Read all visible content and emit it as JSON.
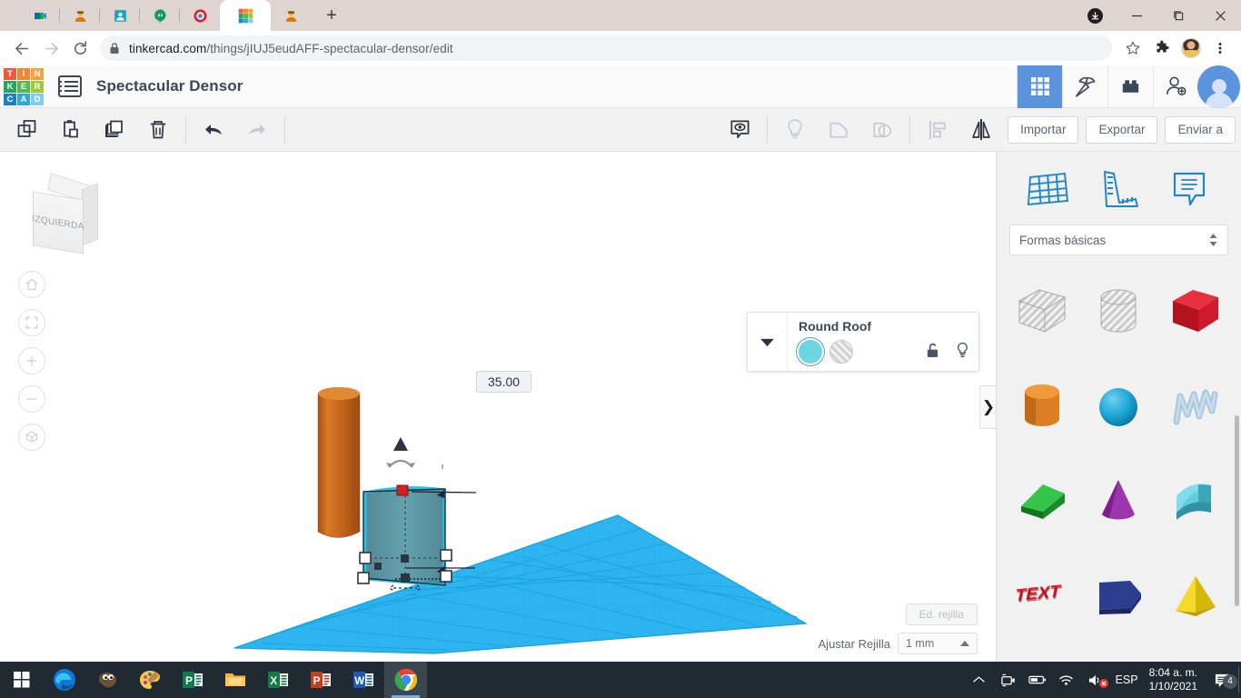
{
  "browser": {
    "tabs": [
      {
        "name": "google-meet-tab",
        "icon": "meet-icon",
        "active": false
      },
      {
        "name": "classroom-tab",
        "icon": "classroom-icon",
        "active": false
      },
      {
        "name": "contacts-tab",
        "icon": "contacts-icon",
        "active": false
      },
      {
        "name": "hangouts-tab",
        "icon": "hangouts-icon",
        "active": false
      },
      {
        "name": "screencast-tab",
        "icon": "screencast-icon",
        "active": false
      },
      {
        "name": "tinkercad-tab",
        "icon": "tinkercad-icon",
        "active": true
      },
      {
        "name": "classroom-tab-2",
        "icon": "classroom-icon",
        "active": false
      }
    ],
    "new_tab_label": "+",
    "url_bold": "tinkercad.com",
    "url_rest": "/things/jIUJ5eudAFF-spectacular-densor/edit",
    "lock_icon": "lock-icon",
    "back_icon": "back-arrow-icon",
    "forward_icon": "forward-arrow-icon",
    "reload_icon": "reload-icon",
    "star_icon": "bookmark-star-icon",
    "extensions_icon": "puzzle-extension-icon",
    "profile_icon": "profile-avatar",
    "menu_icon": "three-dot-menu-icon",
    "download_icon": "download-icon",
    "minimize_icon": "minimize-icon",
    "maximize_icon": "maximize-icon",
    "close_icon": "close-icon"
  },
  "tinkercad": {
    "logo_letters": [
      "T",
      "I",
      "N",
      "K",
      "E",
      "R",
      "C",
      "A",
      "D"
    ],
    "logo_colors": [
      "#f05a3b",
      "#f5852e",
      "#f8a23c",
      "#22a85a",
      "#55b948",
      "#9ecb3b",
      "#1f7fc4",
      "#2fa8d8",
      "#7fcdea"
    ],
    "menu_icon": "list-menu-icon",
    "doc_title": "Spectacular Densor",
    "header_tools": [
      {
        "name": "3d-design-icon",
        "icon": "grid-icon",
        "active": true
      },
      {
        "name": "minecraft-icon",
        "icon": "pickaxe-icon",
        "active": false
      },
      {
        "name": "blocks-icon",
        "icon": "lego-brick-icon",
        "active": false
      },
      {
        "name": "add-user-icon",
        "icon": "person-plus-icon",
        "active": false
      }
    ],
    "account_avatar": "user-avatar"
  },
  "toolbar": {
    "left_tools": [
      {
        "name": "copy-button",
        "icon": "copy-icon",
        "enabled": true
      },
      {
        "name": "paste-button",
        "icon": "paste-icon",
        "enabled": true
      },
      {
        "name": "duplicate-button",
        "icon": "duplicate-icon",
        "enabled": true
      },
      {
        "name": "delete-button",
        "icon": "trash-icon",
        "enabled": true
      },
      {
        "name": "undo-button",
        "icon": "undo-arrow-icon",
        "enabled": true
      },
      {
        "name": "redo-button",
        "icon": "redo-arrow-icon",
        "enabled": false
      }
    ],
    "center_tools": [
      {
        "name": "workplane-view-button",
        "icon": "eye-workplane-icon",
        "enabled": true
      },
      {
        "name": "note-button",
        "icon": "lightbulb-icon",
        "enabled": false
      },
      {
        "name": "group-button",
        "icon": "group-shapes-icon",
        "enabled": false
      },
      {
        "name": "ungroup-button",
        "icon": "ungroup-shapes-icon",
        "enabled": false
      },
      {
        "name": "align-button",
        "icon": "align-icon",
        "enabled": false
      },
      {
        "name": "mirror-button",
        "icon": "mirror-icon",
        "enabled": true
      }
    ],
    "import_label": "Importar",
    "export_label": "Exportar",
    "send_to_label": "Enviar a"
  },
  "canvas": {
    "view_cube_label": "IZQUIERDA",
    "nav_buttons": [
      {
        "name": "home-view-button",
        "icon": "home-icon"
      },
      {
        "name": "fit-view-button",
        "icon": "fit-frame-icon"
      },
      {
        "name": "zoom-in-button",
        "icon": "plus-icon"
      },
      {
        "name": "zoom-out-button",
        "icon": "minus-icon"
      },
      {
        "name": "ortho-perspective-button",
        "icon": "cube-view-icon"
      }
    ],
    "dimension_tooltip": "35.00",
    "grid_edit_label": "Ed. rejilla",
    "snap_label": "Ajustar Rejilla",
    "snap_value": "1 mm",
    "workplane_color": "#2eb4ef",
    "selected_shape_color": "#4e9aa8",
    "cylinder_color": "#c4651c"
  },
  "properties": {
    "shape_name": "Round Roof",
    "collapse_icon": "chevron-down-icon",
    "solid_swatch_color": "#6ed6e0",
    "solid_label": "solid-color-swatch",
    "hole_label": "hole-swatch",
    "lock_icon": "unlock-icon",
    "light_icon": "lightbulb-icon"
  },
  "right_panel": {
    "tabs": [
      {
        "name": "workplane-tool",
        "icon": "workplane-grid-icon"
      },
      {
        "name": "ruler-tool",
        "icon": "ruler-icon"
      },
      {
        "name": "note-tool",
        "icon": "note-bubble-icon"
      }
    ],
    "category_label": "Formas básicas",
    "category_icon": "stepper-arrows-icon",
    "shapes": [
      {
        "name": "box-hole-shape",
        "label": "box-hole",
        "color": "#d9d9d9",
        "kind": "box-hole"
      },
      {
        "name": "cylinder-hole-shape",
        "label": "cylinder-hole",
        "color": "#d9d9d9",
        "kind": "cylinder-hole"
      },
      {
        "name": "box-shape",
        "label": "box",
        "color": "#cf1a2b",
        "kind": "box"
      },
      {
        "name": "cylinder-shape",
        "label": "cylinder",
        "color": "#e8882a",
        "kind": "cylinder"
      },
      {
        "name": "sphere-shape",
        "label": "sphere",
        "color": "#19a4d4",
        "kind": "sphere"
      },
      {
        "name": "scribble-shape",
        "label": "scribble",
        "color": "#a9c7dd",
        "kind": "scribble"
      },
      {
        "name": "wedge-shape",
        "label": "wedge",
        "color": "#25a338",
        "kind": "wedge"
      },
      {
        "name": "cone-shape",
        "label": "cone",
        "color": "#8b2f9e",
        "kind": "cone"
      },
      {
        "name": "roundroof-shape",
        "label": "round-roof",
        "color": "#4fc3d4",
        "kind": "roundroof"
      },
      {
        "name": "text-shape",
        "label": "text",
        "color": "#e01b2b",
        "kind": "text"
      },
      {
        "name": "polygon-shape",
        "label": "polygon",
        "color": "#26387d",
        "kind": "polygon"
      },
      {
        "name": "pyramid-shape",
        "label": "pyramid",
        "color": "#f2cd14",
        "kind": "pyramid"
      }
    ],
    "collapse_handle_icon": "chevron-right-icon"
  },
  "taskbar": {
    "apps": [
      {
        "name": "start-button",
        "icon": "windows-start-icon",
        "active": false
      },
      {
        "name": "edge-taskbar-icon",
        "icon": "edge-icon",
        "active": false
      },
      {
        "name": "gimp-taskbar-icon",
        "icon": "gimp-icon",
        "active": false
      },
      {
        "name": "paint-taskbar-icon",
        "icon": "paint-icon",
        "active": false
      },
      {
        "name": "publisher-taskbar-icon",
        "icon": "publisher-icon",
        "active": false
      },
      {
        "name": "explorer-taskbar-icon",
        "icon": "folder-icon",
        "active": false
      },
      {
        "name": "excel-taskbar-icon",
        "icon": "excel-icon",
        "active": false
      },
      {
        "name": "powerpoint-taskbar-icon",
        "icon": "powerpoint-icon",
        "active": false
      },
      {
        "name": "word-taskbar-icon",
        "icon": "word-icon",
        "active": false
      },
      {
        "name": "chrome-taskbar-icon",
        "icon": "chrome-icon",
        "active": true
      }
    ],
    "tray": {
      "chevron_icon": "show-hidden-icons-icon",
      "camera_icon": "camera-icon",
      "battery_icon": "battery-icon",
      "wifi_icon": "wifi-icon",
      "volume_icon": "volume-muted-icon",
      "language": "ESP",
      "time": "8:04 a. m.",
      "date": "1/10/2021",
      "notification_icon": "notifications-icon",
      "notification_count": "4"
    }
  }
}
